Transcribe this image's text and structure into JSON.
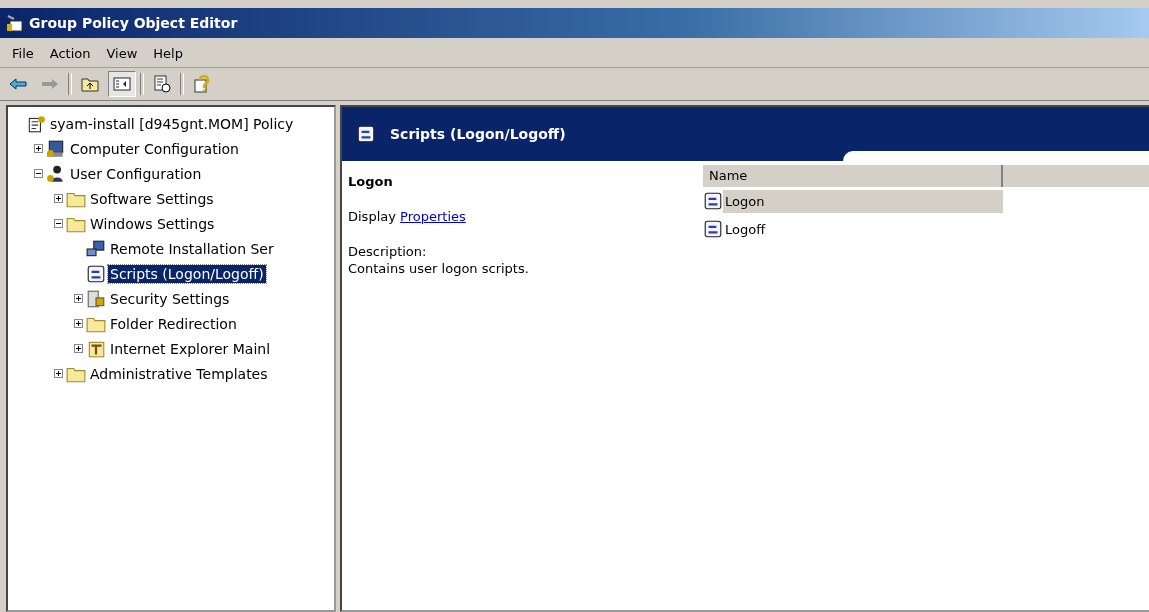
{
  "window": {
    "title": "Group Policy Object Editor"
  },
  "menu": [
    {
      "label": "File"
    },
    {
      "label": "Action"
    },
    {
      "label": "View"
    },
    {
      "label": "Help"
    }
  ],
  "toolbar": [
    {
      "kind": "back",
      "disabled": false
    },
    {
      "kind": "forward",
      "disabled": true
    },
    {
      "kind": "sep"
    },
    {
      "kind": "up",
      "selected": false
    },
    {
      "kind": "tree",
      "selected": true
    },
    {
      "kind": "sep"
    },
    {
      "kind": "export",
      "selected": false
    },
    {
      "kind": "sep"
    },
    {
      "kind": "help",
      "selected": false
    }
  ],
  "tree": [
    {
      "label": "syam-install [d945gnt.MOM] Policy",
      "kind": "policy",
      "selected": false,
      "children": [
        {
          "label": "Computer Configuration",
          "kind": "computer",
          "selected": false,
          "expanded": false
        },
        {
          "label": "User Configuration",
          "kind": "user",
          "selected": false,
          "expanded": true,
          "children": [
            {
              "label": "Software Settings",
              "kind": "folder",
              "selected": false,
              "expanded": false
            },
            {
              "label": "Windows Settings",
              "kind": "folder",
              "selected": false,
              "expanded": true,
              "children": [
                {
                  "label": "Remote Installation Ser",
                  "kind": "remote",
                  "selected": false
                },
                {
                  "label": "Scripts (Logon/Logoff)",
                  "kind": "script",
                  "selected": true
                },
                {
                  "label": "Security Settings",
                  "kind": "security",
                  "selected": false,
                  "expanded": false
                },
                {
                  "label": "Folder Redirection",
                  "kind": "folder",
                  "selected": false,
                  "expanded": false
                },
                {
                  "label": "Internet Explorer Mainl",
                  "kind": "ie",
                  "selected": false,
                  "expanded": false
                }
              ]
            },
            {
              "label": "Administrative Templates",
              "kind": "folder",
              "selected": false,
              "expanded": false
            }
          ]
        }
      ]
    }
  ],
  "details": {
    "title": "Scripts (Logon/Logoff)",
    "heading": "Logon",
    "display_prefix": "Display",
    "display_link": "Properties",
    "description_label": "Description:",
    "description": "Contains user logon scripts."
  },
  "list": {
    "columns": [
      "Name"
    ],
    "rows": [
      {
        "name": "Logon",
        "selected": true
      },
      {
        "name": "Logoff",
        "selected": false
      }
    ]
  }
}
